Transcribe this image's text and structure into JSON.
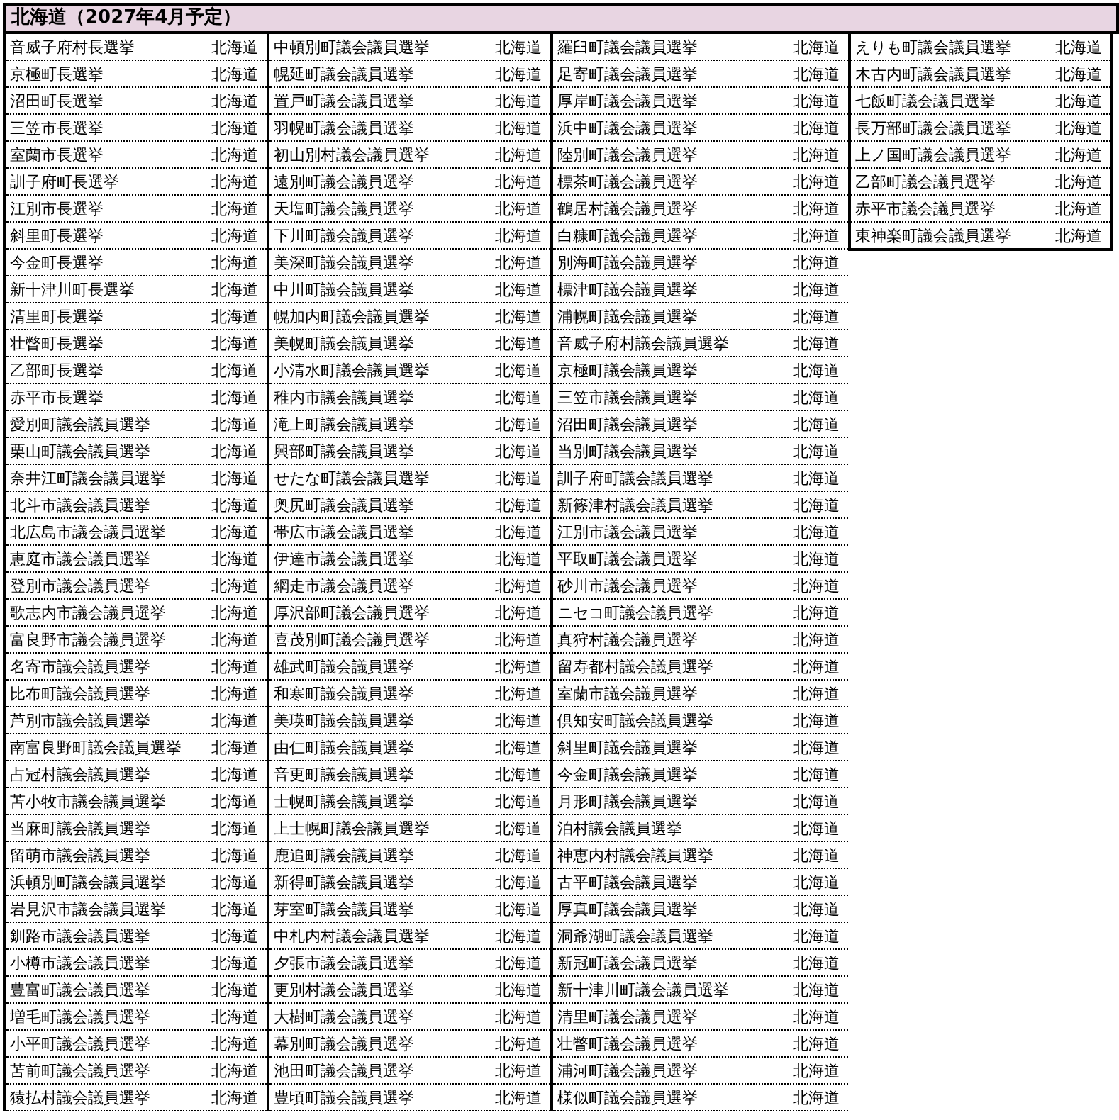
{
  "title": "北海道（2027年4月予定）",
  "columns": [
    {
      "rows": [
        {
          "election": "音威子府村長選挙",
          "prefecture": "北海道"
        },
        {
          "election": "京極町長選挙",
          "prefecture": "北海道"
        },
        {
          "election": "沼田町長選挙",
          "prefecture": "北海道"
        },
        {
          "election": "三笠市長選挙",
          "prefecture": "北海道"
        },
        {
          "election": "室蘭市長選挙",
          "prefecture": "北海道"
        },
        {
          "election": "訓子府町長選挙",
          "prefecture": "北海道"
        },
        {
          "election": "江別市長選挙",
          "prefecture": "北海道"
        },
        {
          "election": "斜里町長選挙",
          "prefecture": "北海道"
        },
        {
          "election": "今金町長選挙",
          "prefecture": "北海道"
        },
        {
          "election": "新十津川町長選挙",
          "prefecture": "北海道"
        },
        {
          "election": "清里町長選挙",
          "prefecture": "北海道"
        },
        {
          "election": "壮瞥町長選挙",
          "prefecture": "北海道"
        },
        {
          "election": "乙部町長選挙",
          "prefecture": "北海道"
        },
        {
          "election": "赤平市長選挙",
          "prefecture": "北海道"
        },
        {
          "election": "愛別町議会議員選挙",
          "prefecture": "北海道"
        },
        {
          "election": "栗山町議会議員選挙",
          "prefecture": "北海道"
        },
        {
          "election": "奈井江町議会議員選挙",
          "prefecture": "北海道"
        },
        {
          "election": "北斗市議会議員選挙",
          "prefecture": "北海道"
        },
        {
          "election": "北広島市議会議員選挙",
          "prefecture": "北海道"
        },
        {
          "election": "恵庭市議会議員選挙",
          "prefecture": "北海道"
        },
        {
          "election": "登別市議会議員選挙",
          "prefecture": "北海道"
        },
        {
          "election": "歌志内市議会議員選挙",
          "prefecture": "北海道"
        },
        {
          "election": "富良野市議会議員選挙",
          "prefecture": "北海道"
        },
        {
          "election": "名寄市議会議員選挙",
          "prefecture": "北海道"
        },
        {
          "election": "比布町議会議員選挙",
          "prefecture": "北海道"
        },
        {
          "election": "芦別市議会議員選挙",
          "prefecture": "北海道"
        },
        {
          "election": "南富良野町議会議員選挙",
          "prefecture": "北海道"
        },
        {
          "election": "占冠村議会議員選挙",
          "prefecture": "北海道"
        },
        {
          "election": "苫小牧市議会議員選挙",
          "prefecture": "北海道"
        },
        {
          "election": "当麻町議会議員選挙",
          "prefecture": "北海道"
        },
        {
          "election": "留萌市議会議員選挙",
          "prefecture": "北海道"
        },
        {
          "election": "浜頓別町議会議員選挙",
          "prefecture": "北海道"
        },
        {
          "election": "岩見沢市議会議員選挙",
          "prefecture": "北海道"
        },
        {
          "election": "釧路市議会議員選挙",
          "prefecture": "北海道"
        },
        {
          "election": "小樽市議会議員選挙",
          "prefecture": "北海道"
        },
        {
          "election": "豊富町議会議員選挙",
          "prefecture": "北海道"
        },
        {
          "election": "増毛町議会議員選挙",
          "prefecture": "北海道"
        },
        {
          "election": "小平町議会議員選挙",
          "prefecture": "北海道"
        },
        {
          "election": "苫前町議会議員選挙",
          "prefecture": "北海道"
        },
        {
          "election": "猿払村議会議員選挙",
          "prefecture": "北海道"
        }
      ]
    },
    {
      "rows": [
        {
          "election": "中頓別町議会議員選挙",
          "prefecture": "北海道"
        },
        {
          "election": "幌延町議会議員選挙",
          "prefecture": "北海道"
        },
        {
          "election": "置戸町議会議員選挙",
          "prefecture": "北海道"
        },
        {
          "election": "羽幌町議会議員選挙",
          "prefecture": "北海道"
        },
        {
          "election": "初山別村議会議員選挙",
          "prefecture": "北海道"
        },
        {
          "election": "遠別町議会議員選挙",
          "prefecture": "北海道"
        },
        {
          "election": "天塩町議会議員選挙",
          "prefecture": "北海道"
        },
        {
          "election": "下川町議会議員選挙",
          "prefecture": "北海道"
        },
        {
          "election": "美深町議会議員選挙",
          "prefecture": "北海道"
        },
        {
          "election": "中川町議会議員選挙",
          "prefecture": "北海道"
        },
        {
          "election": "幌加内町議会議員選挙",
          "prefecture": "北海道"
        },
        {
          "election": "美幌町議会議員選挙",
          "prefecture": "北海道"
        },
        {
          "election": "小清水町議会議員選挙",
          "prefecture": "北海道"
        },
        {
          "election": "稚内市議会議員選挙",
          "prefecture": "北海道"
        },
        {
          "election": "滝上町議会議員選挙",
          "prefecture": "北海道"
        },
        {
          "election": "興部町議会議員選挙",
          "prefecture": "北海道"
        },
        {
          "election": "せたな町議会議員選挙",
          "prefecture": "北海道"
        },
        {
          "election": "奥尻町議会議員選挙",
          "prefecture": "北海道"
        },
        {
          "election": "帯広市議会議員選挙",
          "prefecture": "北海道"
        },
        {
          "election": "伊達市議会議員選挙",
          "prefecture": "北海道"
        },
        {
          "election": "網走市議会議員選挙",
          "prefecture": "北海道"
        },
        {
          "election": "厚沢部町議会議員選挙",
          "prefecture": "北海道"
        },
        {
          "election": "喜茂別町議会議員選挙",
          "prefecture": "北海道"
        },
        {
          "election": "雄武町議会議員選挙",
          "prefecture": "北海道"
        },
        {
          "election": "和寒町議会議員選挙",
          "prefecture": "北海道"
        },
        {
          "election": "美瑛町議会議員選挙",
          "prefecture": "北海道"
        },
        {
          "election": "由仁町議会議員選挙",
          "prefecture": "北海道"
        },
        {
          "election": "音更町議会議員選挙",
          "prefecture": "北海道"
        },
        {
          "election": "士幌町議会議員選挙",
          "prefecture": "北海道"
        },
        {
          "election": "上士幌町議会議員選挙",
          "prefecture": "北海道"
        },
        {
          "election": "鹿追町議会議員選挙",
          "prefecture": "北海道"
        },
        {
          "election": "新得町議会議員選挙",
          "prefecture": "北海道"
        },
        {
          "election": "芽室町議会議員選挙",
          "prefecture": "北海道"
        },
        {
          "election": "中札内村議会議員選挙",
          "prefecture": "北海道"
        },
        {
          "election": "夕張市議会議員選挙",
          "prefecture": "北海道"
        },
        {
          "election": "更別村議会議員選挙",
          "prefecture": "北海道"
        },
        {
          "election": "大樹町議会議員選挙",
          "prefecture": "北海道"
        },
        {
          "election": "幕別町議会議員選挙",
          "prefecture": "北海道"
        },
        {
          "election": "池田町議会議員選挙",
          "prefecture": "北海道"
        },
        {
          "election": "豊頃町議会議員選挙",
          "prefecture": "北海道"
        }
      ]
    },
    {
      "rows": [
        {
          "election": "羅臼町議会議員選挙",
          "prefecture": "北海道"
        },
        {
          "election": "足寄町議会議員選挙",
          "prefecture": "北海道"
        },
        {
          "election": "厚岸町議会議員選挙",
          "prefecture": "北海道"
        },
        {
          "election": "浜中町議会議員選挙",
          "prefecture": "北海道"
        },
        {
          "election": "陸別町議会議員選挙",
          "prefecture": "北海道"
        },
        {
          "election": "標茶町議会議員選挙",
          "prefecture": "北海道"
        },
        {
          "election": "鶴居村議会議員選挙",
          "prefecture": "北海道"
        },
        {
          "election": "白糠町議会議員選挙",
          "prefecture": "北海道"
        },
        {
          "election": "別海町議会議員選挙",
          "prefecture": "北海道"
        },
        {
          "election": "標津町議会議員選挙",
          "prefecture": "北海道"
        },
        {
          "election": "浦幌町議会議員選挙",
          "prefecture": "北海道"
        },
        {
          "election": "音威子府村議会議員選挙",
          "prefecture": "北海道"
        },
        {
          "election": "京極町議会議員選挙",
          "prefecture": "北海道"
        },
        {
          "election": "三笠市議会議員選挙",
          "prefecture": "北海道"
        },
        {
          "election": "沼田町議会議員選挙",
          "prefecture": "北海道"
        },
        {
          "election": "当別町議会議員選挙",
          "prefecture": "北海道"
        },
        {
          "election": "訓子府町議会議員選挙",
          "prefecture": "北海道"
        },
        {
          "election": "新篠津村議会議員選挙",
          "prefecture": "北海道"
        },
        {
          "election": "江別市議会議員選挙",
          "prefecture": "北海道"
        },
        {
          "election": "平取町議会議員選挙",
          "prefecture": "北海道"
        },
        {
          "election": "砂川市議会議員選挙",
          "prefecture": "北海道"
        },
        {
          "election": "ニセコ町議会議員選挙",
          "prefecture": "北海道"
        },
        {
          "election": "真狩村議会議員選挙",
          "prefecture": "北海道"
        },
        {
          "election": "留寿都村議会議員選挙",
          "prefecture": "北海道"
        },
        {
          "election": "室蘭市議会議員選挙",
          "prefecture": "北海道"
        },
        {
          "election": "倶知安町議会議員選挙",
          "prefecture": "北海道"
        },
        {
          "election": "斜里町議会議員選挙",
          "prefecture": "北海道"
        },
        {
          "election": "今金町議会議員選挙",
          "prefecture": "北海道"
        },
        {
          "election": "月形町議会議員選挙",
          "prefecture": "北海道"
        },
        {
          "election": "泊村議会議員選挙",
          "prefecture": "北海道"
        },
        {
          "election": "神恵内村議会議員選挙",
          "prefecture": "北海道"
        },
        {
          "election": "古平町議会議員選挙",
          "prefecture": "北海道"
        },
        {
          "election": "厚真町議会議員選挙",
          "prefecture": "北海道"
        },
        {
          "election": "洞爺湖町議会議員選挙",
          "prefecture": "北海道"
        },
        {
          "election": "新冠町議会議員選挙",
          "prefecture": "北海道"
        },
        {
          "election": "新十津川町議会議員選挙",
          "prefecture": "北海道"
        },
        {
          "election": "清里町議会議員選挙",
          "prefecture": "北海道"
        },
        {
          "election": "壮瞥町議会議員選挙",
          "prefecture": "北海道"
        },
        {
          "election": "浦河町議会議員選挙",
          "prefecture": "北海道"
        },
        {
          "election": "様似町議会議員選挙",
          "prefecture": "北海道"
        }
      ]
    },
    {
      "rows": [
        {
          "election": "えりも町議会議員選挙",
          "prefecture": "北海道"
        },
        {
          "election": "木古内町議会議員選挙",
          "prefecture": "北海道"
        },
        {
          "election": "七飯町議会議員選挙",
          "prefecture": "北海道"
        },
        {
          "election": "長万部町議会議員選挙",
          "prefecture": "北海道"
        },
        {
          "election": "上ノ国町議会議員選挙",
          "prefecture": "北海道"
        },
        {
          "election": "乙部町議会議員選挙",
          "prefecture": "北海道"
        },
        {
          "election": "赤平市議会議員選挙",
          "prefecture": "北海道"
        },
        {
          "election": "東神楽町議会議員選挙",
          "prefecture": "北海道"
        }
      ]
    }
  ]
}
